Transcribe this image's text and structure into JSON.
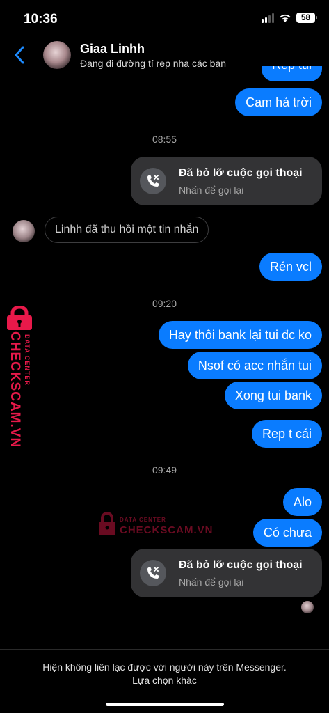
{
  "status_bar": {
    "time": "10:36",
    "battery": "58"
  },
  "header": {
    "name": "Giaa Linhh",
    "status": "Đang đi đường tí rep nha các bạn"
  },
  "messages": {
    "partial_top": "Rep tui",
    "m1": "Cam hả trời",
    "ts1": "08:55",
    "missed_call_title": "Đã bỏ lỡ cuộc gọi thoại",
    "missed_call_sub": "Nhấn để gọi lại",
    "unsent_notice": "Linhh đã thu hồi một tin nhắn",
    "m2": "Rén vcl",
    "ts2": "09:20",
    "m3": "Hay thôi bank lại tui đc ko",
    "m4": "Nsof có acc nhắn tui",
    "m5": "Xong tui bank",
    "m6": "Rep t cái",
    "ts3": "09:49",
    "m7": "Alo",
    "m8": "Có chưa",
    "missed_call2_title": "Đã bỏ lỡ cuộc gọi thoại",
    "missed_call2_sub": "Nhấn để gọi lại"
  },
  "watermark": {
    "brand": "CHECKSCAM.VN",
    "sub": "DATA CENTER"
  },
  "footer": {
    "message": "Hiện không liên lạc được với người này trên Messenger.",
    "link": "Lựa chọn khác"
  },
  "colors": {
    "accent": "#0a7cff",
    "card": "#333335",
    "watermark": "#e8194a"
  }
}
